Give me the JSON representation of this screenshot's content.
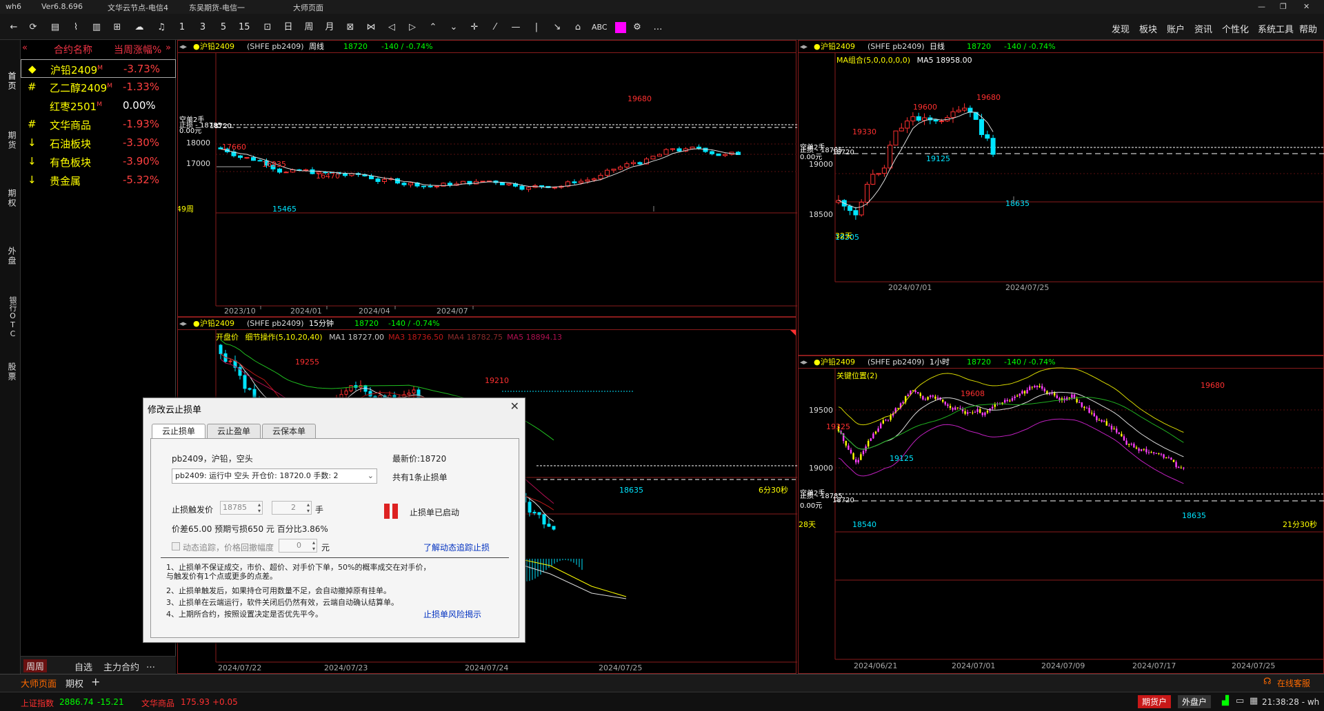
{
  "topbar": {
    "app": "wh6",
    "ver": "Ver6.8.696",
    "node1": "文华云节点-电信4",
    "node2": "东吴期货-电信一",
    "page": "大师页面"
  },
  "toolbar": {
    "nums": [
      "1",
      "3",
      "5",
      "15"
    ],
    "day": "日",
    "week": "周",
    "month": "月",
    "abc": "ABC",
    "more": "…",
    "right": [
      "发现",
      "板块",
      "账户",
      "资讯",
      "个性化",
      "系统工具",
      "帮助"
    ]
  },
  "lefttabs": [
    "首页",
    "期货",
    "期权",
    "外盘",
    "银行OTC",
    "股票"
  ],
  "watch": {
    "col1": "合约名称",
    "col2": "当周涨幅%",
    "rows": [
      {
        "mark": "◆",
        "name": "沪铅2409",
        "sup": "M",
        "chg": "-3.73%",
        "color": "#ff4040"
      },
      {
        "mark": "#",
        "name": "乙二醇2409",
        "sup": "M",
        "chg": "-1.33%",
        "color": "#ff4040"
      },
      {
        "mark": "",
        "name": "红枣2501",
        "sup": "M",
        "chg": "0.00%",
        "color": "#ffffff"
      },
      {
        "mark": "#",
        "name": "文华商品",
        "sup": "",
        "chg": "-1.93%",
        "color": "#ff4040"
      },
      {
        "mark": "↓",
        "name": "石油板块",
        "sup": "",
        "chg": "-3.30%",
        "color": "#ff4040"
      },
      {
        "mark": "↓",
        "name": "有色板块",
        "sup": "",
        "chg": "-3.90%",
        "color": "#ff4040"
      },
      {
        "mark": "↓",
        "name": "贵金属",
        "sup": "",
        "chg": "-5.32%",
        "color": "#ff4040"
      }
    ],
    "foot": [
      "周周",
      "自选",
      "主力合约",
      "…"
    ]
  },
  "panels": {
    "p1": {
      "name": "沪铅2409",
      "code": "(SHFE pb2409)",
      "period": "周线",
      "price": "18720",
      "chg": "-140 / -0.74%",
      "y": [
        "18000",
        "17000"
      ],
      "lbl_empty": "空单2手",
      "lbl_zero": "0.00元",
      "lbl_stop": "止损",
      "l1": "18785",
      "l2": "18720",
      "marks": [
        "19680",
        "17660",
        "16935",
        "16470",
        "15465"
      ],
      "bars": "49周",
      "x": [
        "2023/10",
        "2024/01",
        "2024/04",
        "2024/07"
      ]
    },
    "p2": {
      "name": "沪铅2409",
      "code": "(SHFE pb2409)",
      "period": "15分钟",
      "price": "18720",
      "chg": "-140 / -0.74%",
      "ind": "开盘价",
      "op": "细节操作(5,10,20,40)",
      "ma": [
        {
          "t": "MA1 18727.00",
          "c": "#c8c8c8"
        },
        {
          "t": "MA3 18736.50",
          "c": "#c01818"
        },
        {
          "t": "MA4 18782.75",
          "c": "#8a2a2a"
        },
        {
          "t": "MA5 18894.13",
          "c": "#b01050"
        }
      ],
      "marks": [
        "19255",
        "19210",
        "18635"
      ],
      "timer": "6分30秒",
      "x": [
        "2024/07/22",
        "2024/07/23",
        "2024/07/24",
        "2024/07/25"
      ]
    },
    "p3": {
      "name": "沪铅2409",
      "code": "(SHFE pb2409)",
      "period": "日线",
      "price": "18720",
      "chg": "-140 / -0.74%",
      "ma": "MA组合(5,0,0,0,0,0)",
      "ma5": "MA5 18958.00",
      "y": [
        "19000",
        "18500"
      ],
      "lbl_empty": "空单2手",
      "lbl_zero": "0.00元",
      "lbl_stop": "止损",
      "l1": "18785",
      "l2": "18720",
      "marks": [
        "19600",
        "19680",
        "19330",
        "19125",
        "18635",
        "18305"
      ],
      "bars": "32天",
      "x": [
        "2024/07/01",
        "2024/07/25"
      ]
    },
    "p4": {
      "name": "沪铅2409",
      "code": "(SHFE pb2409)",
      "period": "1小时",
      "price": "18720",
      "chg": "-140 / -0.74%",
      "ind": "关键位置(2)",
      "y": [
        "19500",
        "19000"
      ],
      "lbl_empty": "空单2手",
      "lbl_zero": "0.00元",
      "lbl_stop": "止损",
      "l1": "18785",
      "l2": "18720",
      "marks": [
        "19680",
        "19608",
        "19325",
        "19125",
        "18540",
        "18635"
      ],
      "bars": "28天",
      "timer": "21分30秒",
      "x": [
        "2024/06/21",
        "2024/07/01",
        "2024/07/09",
        "2024/07/17",
        "2024/07/25"
      ]
    }
  },
  "dialog": {
    "title": "修改云止损单",
    "tabs": [
      "云止损单",
      "云止盈单",
      "云保本单"
    ],
    "contract": "pb2409，沪铅，空头",
    "last": "最新价:18720",
    "select": "pb2409: 运行中 空头 开仓价: 18720.0 手数: 2",
    "count": "共有1条止损单",
    "trig_lbl": "止损触发价",
    "trig_val": "18785",
    "qty": "2",
    "hand": "手",
    "status": "止损单已启动",
    "diff": "价差65.00  预期亏损650 元  百分比3.86%",
    "dyn": "动态追踪，价格回撤幅度",
    "dyn_val": "0",
    "yuan": "元",
    "link1": "了解动态追踪止损",
    "notes": [
      "1、止损单不保证成交，市价、超价、对手价下单，50%的概率成交在对手价，与触发价有1个点或更多的点差。",
      "2、止损单触发后，如果持仓可用数量不足，会自动撤掉原有挂单。",
      "3、止损单在云端运行，软件关闭后仍然有效，云端自动确认结算单。",
      "4、上期所合约，按照设置决定是否优先平今。"
    ],
    "link2": "止损单风险揭示"
  },
  "status": {
    "tab1": "大师页面",
    "tab2": "期权",
    "service": "在线客服"
  },
  "status2": {
    "idx_name": "上证指数",
    "idx_val": "2886.74",
    "idx_chg": "-15.21",
    "com_name": "文华商品",
    "com_val": "175.93",
    "com_chg": "+0.05",
    "btn1": "期货户",
    "btn2": "外盘户",
    "time": "21:38:28 - wh"
  },
  "colors": {
    "up": "#ff3030",
    "down": "#00e5ff",
    "frame": "#8a1c1c",
    "accent": "#ff00ff"
  }
}
